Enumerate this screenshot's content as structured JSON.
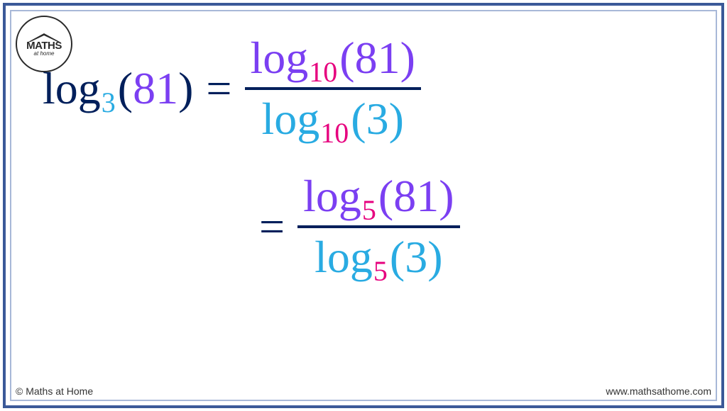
{
  "logo": {
    "line1": "MATHS",
    "line2": "at home"
  },
  "equation": {
    "lhs": {
      "log": "log",
      "base": "3",
      "arg_open": "(",
      "arg": "81",
      "arg_close": ")"
    },
    "equals": "=",
    "frac1": {
      "num": {
        "log": "log",
        "base": "10",
        "arg_open": "(",
        "arg": "81",
        "arg_close": ")"
      },
      "den": {
        "log": "log",
        "base": "10",
        "arg_open": "(",
        "arg": "3",
        "arg_close": ")"
      }
    },
    "frac2": {
      "num": {
        "log": "log",
        "base": "5",
        "arg_open": " (",
        "arg": "81",
        "arg_close": ")"
      },
      "den": {
        "log": "log",
        "base": "5",
        "arg_open": " (",
        "arg": "3",
        "arg_close": ")"
      }
    }
  },
  "footer": {
    "copyright": "© Maths at Home",
    "url": "www.mathsathome.com"
  }
}
